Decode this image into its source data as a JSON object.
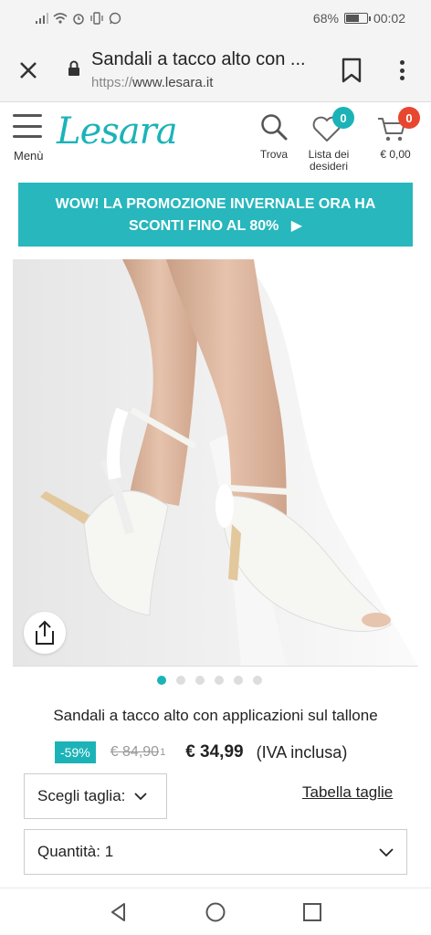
{
  "status_bar": {
    "battery": "68%",
    "time": "00:02",
    "battery_level": 0.68
  },
  "browser": {
    "page_title": "Sandali a tacco alto con ...",
    "url_protocol": "https://",
    "url_domain": "www.lesara.it"
  },
  "site_header": {
    "menu_label": "Menù",
    "logo": "Lesara",
    "search_label": "Trova",
    "wishlist_label_line1": "Lista dei",
    "wishlist_label_line2": "desideri",
    "wishlist_count": "0",
    "cart_count": "0",
    "cart_total": "€ 0,00",
    "accent_color": "#1bb3b8",
    "badge_color": "#e8472f"
  },
  "promo": {
    "line1": "WOW! LA PROMOZIONE INVERNALE ORA HA",
    "line2": "SCONTI FINO AL 80%",
    "arrow": "▶"
  },
  "gallery": {
    "total_images": 6,
    "active_index": 0
  },
  "product": {
    "title": "Sandali a tacco alto con applicazioni sul tallone",
    "discount": "-59%",
    "old_price": "€ 84,90",
    "old_price_note": "1",
    "price": "€ 34,99",
    "vat_note": "(IVA inclusa)",
    "size_select_label": "Scegli taglia:",
    "size_table_link": "Tabella taglie",
    "quantity_label": "Quantità: 1"
  }
}
